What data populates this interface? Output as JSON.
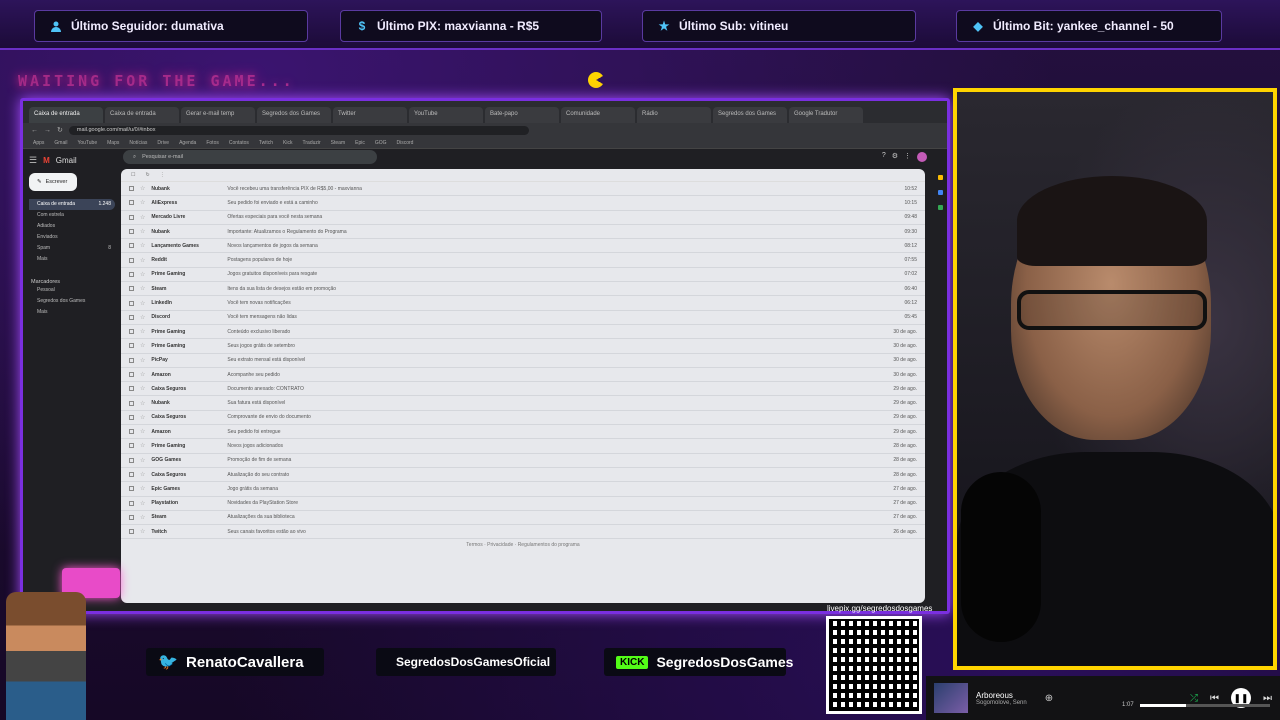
{
  "alerts": [
    {
      "icon": "user-icon",
      "text": "Último Seguidor: dumativa"
    },
    {
      "icon": "dollar-icon",
      "text": "Último PIX: maxvianna - R$5"
    },
    {
      "icon": "star-icon",
      "text": "Último Sub: vitineu"
    },
    {
      "icon": "diamond-icon",
      "text": "Último Bit: yankee_channel - 50"
    }
  ],
  "overlay_title": "WAITING FOR THE GAME...",
  "browser": {
    "tabs": [
      "Caixa de entrada",
      "Caixa de entrada",
      "Gerar e-mail temp",
      "Segredos dos Games",
      "Twitter",
      "YouTube",
      "Bate-papo",
      "Comunidade",
      "Rádio",
      "Segredos dos Games",
      "Google Tradutor"
    ],
    "address": "mail.google.com/mail/u/0/#inbox",
    "bookmarks": [
      "Apps",
      "Gmail",
      "YouTube",
      "Maps",
      "Notícias",
      "Drive",
      "Agenda",
      "Fotos",
      "Contatos",
      "Twitch",
      "Kick",
      "Traduzir",
      "Steam",
      "Epic",
      "GOG",
      "Discord"
    ]
  },
  "gmail": {
    "logo": "Gmail",
    "search_placeholder": "Pesquisar e-mail",
    "compose_label": "Escrever",
    "nav": [
      {
        "label": "Caixa de entrada",
        "count": "1.248",
        "active": true
      },
      {
        "label": "Com estrela",
        "count": ""
      },
      {
        "label": "Adiados",
        "count": ""
      },
      {
        "label": "Enviados",
        "count": ""
      },
      {
        "label": "Spam",
        "count": "8"
      },
      {
        "label": "Mais",
        "count": ""
      }
    ],
    "labels_heading": "Marcadores",
    "labels": [
      "Pessoal",
      "Segredos dos Games",
      "Mais"
    ],
    "rows": [
      {
        "sender": "Nubank",
        "snippet": "Você recebeu uma transferência PIX de R$5,00 - maxvianna",
        "date": "10:52"
      },
      {
        "sender": "AliExpress",
        "snippet": "Seu pedido foi enviado e está a caminho",
        "date": "10:15"
      },
      {
        "sender": "Mercado Livre",
        "snippet": "Ofertas especiais para você nesta semana",
        "date": "09:48"
      },
      {
        "sender": "Nubank",
        "snippet": "Importante: Atualizamos o Regulamento do Programa",
        "date": "09:30"
      },
      {
        "sender": "Lançamento Games",
        "snippet": "Novos lançamentos de jogos da semana",
        "date": "08:12"
      },
      {
        "sender": "Reddit",
        "snippet": "Postagens populares de hoje",
        "date": "07:55"
      },
      {
        "sender": "Prime Gaming",
        "snippet": "Jogos gratuitos disponíveis para resgate",
        "date": "07:02"
      },
      {
        "sender": "Steam",
        "snippet": "Itens da sua lista de desejos estão em promoção",
        "date": "06:40"
      },
      {
        "sender": "LinkedIn",
        "snippet": "Você tem novas notificações",
        "date": "06:12"
      },
      {
        "sender": "Discord",
        "snippet": "Você tem mensagens não lidas",
        "date": "05:45"
      },
      {
        "sender": "Prime Gaming",
        "snippet": "Conteúdo exclusivo liberado",
        "date": "30 de ago."
      },
      {
        "sender": "Prime Gaming",
        "snippet": "Seus jogos grátis de setembro",
        "date": "30 de ago."
      },
      {
        "sender": "PicPay",
        "snippet": "Seu extrato mensal está disponível",
        "date": "30 de ago."
      },
      {
        "sender": "Amazon",
        "snippet": "Acompanhe seu pedido",
        "date": "30 de ago."
      },
      {
        "sender": "Caixa Seguros",
        "snippet": "Documento anexado: CONTRATO",
        "date": "29 de ago."
      },
      {
        "sender": "Nubank",
        "snippet": "Sua fatura está disponível",
        "date": "29 de ago."
      },
      {
        "sender": "Caixa Seguros",
        "snippet": "Comprovante de envio do documento",
        "date": "29 de ago."
      },
      {
        "sender": "Amazon",
        "snippet": "Seu pedido foi entregue",
        "date": "29 de ago."
      },
      {
        "sender": "Prime Gaming",
        "snippet": "Novos jogos adicionados",
        "date": "28 de ago."
      },
      {
        "sender": "GOG Games",
        "snippet": "Promoção de fim de semana",
        "date": "28 de ago."
      },
      {
        "sender": "Caixa Seguros",
        "snippet": "Atualização do seu contrato",
        "date": "28 de ago."
      },
      {
        "sender": "Epic Games",
        "snippet": "Jogo grátis da semana",
        "date": "27 de ago."
      },
      {
        "sender": "Playstation",
        "snippet": "Novidades da PlayStation Store",
        "date": "27 de ago."
      },
      {
        "sender": "Steam",
        "snippet": "Atualizações da sua biblioteca",
        "date": "27 de ago."
      },
      {
        "sender": "Twitch",
        "snippet": "Seus canais favoritos estão ao vivo",
        "date": "26 de ago."
      }
    ],
    "footer": "Termos · Privacidade · Regulamentos do programa"
  },
  "socials": [
    {
      "icon": "twitter-icon",
      "text": "RenatoCavallera"
    },
    {
      "icon": "instagram-icon",
      "text": "SegredosDosGamesOficial"
    },
    {
      "icon": "kick-icon",
      "badge": "KICK",
      "text": "SegredosDosGames"
    }
  ],
  "qr_label": "livepix.gg/segredosdosgames",
  "player": {
    "title": "Arboreous",
    "artist": "Sogomolove, Senn",
    "time": "1:07",
    "progress": 0.35
  }
}
